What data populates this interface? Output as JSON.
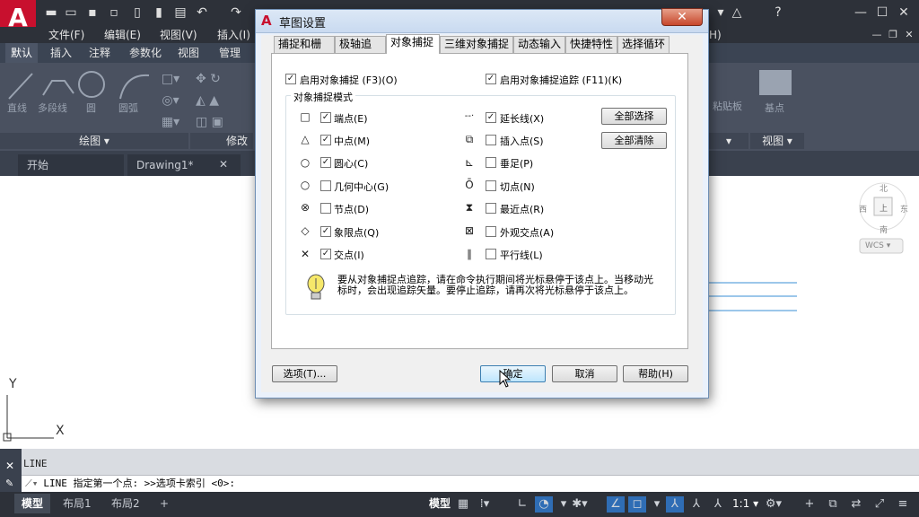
{
  "app": {
    "logo": "A",
    "menu": [
      "文件(F)",
      "编辑(E)",
      "视图(V)",
      "插入(I)"
    ],
    "menu_right": "H)"
  },
  "ribbon": {
    "tabs": [
      "默认",
      "插入",
      "注释",
      "参数化",
      "视图",
      "管理"
    ],
    "active_tab": "默认",
    "tools": [
      "直线",
      "多段线",
      "圆",
      "圆弧"
    ],
    "sections": {
      "draw": "绘图 ▾",
      "modify": "修改",
      "view": "视图 ▾"
    },
    "right_tools": [
      "粘贴板",
      "基点"
    ]
  },
  "doc_tabs": {
    "start": "开始",
    "drawing": "Drawing1*",
    "close": "✕"
  },
  "viewcube": {
    "north": "北",
    "south": "南",
    "west": "西",
    "east": "东",
    "top": "上",
    "wcs": "WCS ▾"
  },
  "ucs": {
    "x": "X",
    "y": "Y"
  },
  "command": {
    "history": "LINE",
    "prompt": "LINE 指定第一个点: >>选项卡索引 <0>:"
  },
  "status": {
    "layout_tabs": [
      "模型",
      "布局1",
      "布局2"
    ],
    "add": "+",
    "model": "模型",
    "scale": "1:1 ▾"
  },
  "dialog": {
    "title": "草图设置",
    "close": "✕",
    "tabs": [
      "捕捉和栅格",
      "极轴追踪",
      "对象捕捉",
      "三维对象捕捉",
      "动态输入",
      "快捷特性",
      "选择循环"
    ],
    "active_tab": "对象捕捉",
    "enable_osnap": {
      "label": "启用对象捕捉 (F3)(O)",
      "checked": true
    },
    "enable_track": {
      "label": "启用对象捕捉追踪 (F11)(K)",
      "checked": true
    },
    "group_label": "对象捕捉模式",
    "modes_left": [
      {
        "sym": "□",
        "label": "端点(E)",
        "checked": true
      },
      {
        "sym": "△",
        "label": "中点(M)",
        "checked": true
      },
      {
        "sym": "○",
        "label": "圆心(C)",
        "checked": true
      },
      {
        "sym": "○",
        "label": "几何中心(G)",
        "checked": false
      },
      {
        "sym": "⊗",
        "label": "节点(D)",
        "checked": false
      },
      {
        "sym": "◇",
        "label": "象限点(Q)",
        "checked": true
      },
      {
        "sym": "✕",
        "label": "交点(I)",
        "checked": true
      }
    ],
    "modes_right": [
      {
        "sym": "--·",
        "label": "延长线(X)",
        "checked": true
      },
      {
        "sym": "⧉",
        "label": "插入点(S)",
        "checked": false
      },
      {
        "sym": "⊾",
        "label": "垂足(P)",
        "checked": false
      },
      {
        "sym": "Ō",
        "label": "切点(N)",
        "checked": false
      },
      {
        "sym": "⧗",
        "label": "最近点(R)",
        "checked": false
      },
      {
        "sym": "⊠",
        "label": "外观交点(A)",
        "checked": false
      },
      {
        "sym": "∥",
        "label": "平行线(L)",
        "checked": false
      }
    ],
    "select_all": "全部选择",
    "clear_all": "全部清除",
    "tip": "要从对象捕捉点追踪，请在命令执行期间将光标悬停于该点上。当移动光标时，会出现追踪矢量。要停止追踪，请再次将光标悬停于该点上。",
    "options": "选项(T)...",
    "ok": "确定",
    "cancel": "取消",
    "help": "帮助(H)"
  }
}
